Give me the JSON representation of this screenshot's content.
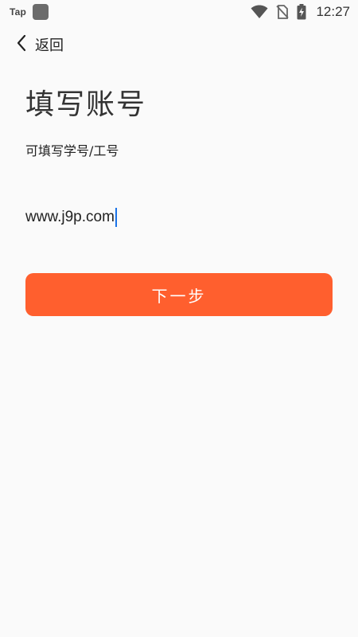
{
  "status_bar": {
    "app_label": "Tap",
    "time": "12:27",
    "icons": [
      "wifi-icon",
      "no-sim-icon",
      "battery-charging-icon"
    ]
  },
  "nav": {
    "back_label": "返回"
  },
  "title": "填写账号",
  "subtitle": "可填写学号/工号",
  "account_input": {
    "value": "www.j9p.com"
  },
  "next_button": {
    "label": "下一步"
  },
  "colors": {
    "accent": "#ff5f2e",
    "background": "#fafafa",
    "caret": "#1a73e8"
  }
}
